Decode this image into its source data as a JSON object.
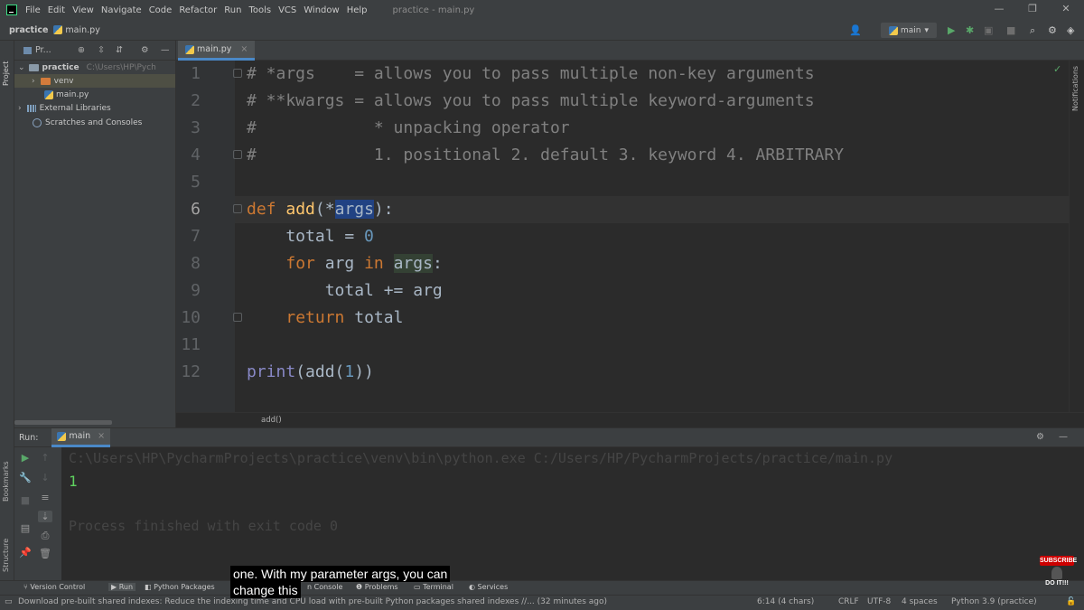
{
  "menubar": {
    "items": [
      "File",
      "Edit",
      "View",
      "Navigate",
      "Code",
      "Refactor",
      "Run",
      "Tools",
      "VCS",
      "Window",
      "Help"
    ],
    "window_title": "practice - main.py",
    "minimize": "—",
    "restore": "❐",
    "close": "✕"
  },
  "navbar": {
    "project": "practice",
    "file": "main.py",
    "branch": "main",
    "run_config_caret": "▾"
  },
  "left_stripe": {
    "project_label": "Project",
    "bookmarks_label": "Bookmarks",
    "structure_label": "Structure"
  },
  "right_stripe": {
    "notifications_label": "Notifications"
  },
  "project_panel": {
    "header_label": "Pr...",
    "tree": [
      {
        "label": "practice",
        "path": "C:\\Users\\HP\\Pych"
      },
      {
        "label": "venv"
      },
      {
        "label": "main.py"
      },
      {
        "label": "External Libraries"
      },
      {
        "label": "Scratches and Consoles"
      }
    ]
  },
  "editor": {
    "tab_label": "main.py",
    "line_numbers": [
      "1",
      "2",
      "3",
      "4",
      "5",
      "6",
      "7",
      "8",
      "9",
      "10",
      "11",
      "12"
    ],
    "code": {
      "l1": "# *args    = allows you to pass multiple non-key arguments",
      "l2": "# **kwargs = allows you to pass multiple keyword-arguments",
      "l3": "#            * unpacking operator",
      "l4": "#            1. positional 2. default 3. keyword 4. ARBITRARY",
      "l6_def": "def",
      "l6_name": "add",
      "l6_open": "(*",
      "l6_param": "args",
      "l6_close": "):",
      "l7_a": "    total = ",
      "l7_num": "0",
      "l8_for": "for",
      "l8_mid": " arg ",
      "l8_in": "in",
      "l8_args": "args",
      "l8_colon": ":",
      "l9": "        total += arg",
      "l10_ret": "return",
      "l10_rest": " total",
      "l12_print": "print",
      "l12_a": "(add(",
      "l12_num": "1",
      "l12_b": "))"
    },
    "breadcrumb": "add()"
  },
  "run_panel": {
    "label": "Run:",
    "tab": "main",
    "command": "C:\\Users\\HP\\PycharmProjects\\practice\\venv\\bin\\python.exe C:/Users/HP/PycharmProjects/practice/main.py",
    "output": "1",
    "exit_message": "Process finished with exit code 0"
  },
  "tool_stripe": {
    "version_control": "Version Control",
    "run": "Run",
    "python_packages": "Python Packages",
    "console": "n Console",
    "problems": "Problems",
    "terminal": "Terminal",
    "services": "Services"
  },
  "status_bar": {
    "message": "Download pre-built shared indexes: Reduce the indexing time and CPU load with pre-built Python packages shared indexes //... (32 minutes ago)",
    "position": "6:14 (4 chars)",
    "line_sep": "CRLF",
    "encoding": "UTF-8",
    "indent": "4 spaces",
    "interpreter": "Python 3.9 (practice)"
  },
  "captions": {
    "line1": "one. With my parameter args, you can",
    "line2": "change this"
  },
  "badge": {
    "subscribe": "SUBSCRIBE",
    "tagline": "DO IT!!!"
  },
  "colors": {
    "accent": "#4a88c7",
    "selection": "#214283",
    "output_green": "#5fd35f"
  }
}
